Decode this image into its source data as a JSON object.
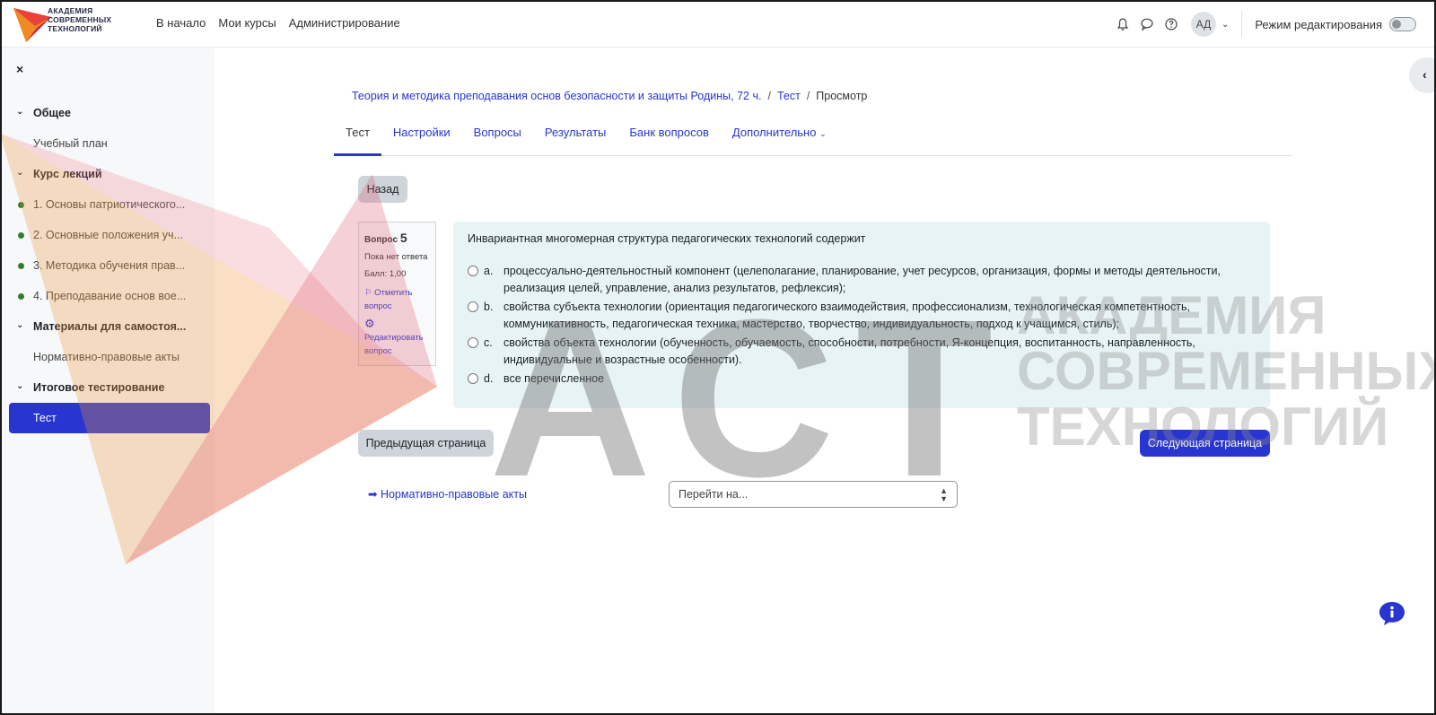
{
  "brand": {
    "logo_text_lines": [
      "АКАДЕМИЯ",
      "СОВРЕМЕННЫХ",
      "ТЕХНОЛОГИЙ"
    ],
    "accent_color": "#2835d1"
  },
  "navbar": {
    "links": [
      "В начало",
      "Мои курсы",
      "Администрирование"
    ],
    "avatar_initials": "АД",
    "edit_mode_label": "Режим редактирования"
  },
  "sidebar": {
    "close_label": "×",
    "items": [
      {
        "label": "Общее",
        "type": "section"
      },
      {
        "label": "Учебный план",
        "type": "child"
      },
      {
        "label": "Курс лекций",
        "type": "section"
      },
      {
        "label": "1. Основы патриотического...",
        "type": "child-dot"
      },
      {
        "label": "2. Основные положения уч...",
        "type": "child-dot"
      },
      {
        "label": "3. Методика обучения прав...",
        "type": "child-dot"
      },
      {
        "label": "4. Преподавание основ вое...",
        "type": "child-dot"
      },
      {
        "label": "Материалы для самостоя...",
        "type": "section"
      },
      {
        "label": "Нормативно-правовые акты",
        "type": "child"
      },
      {
        "label": "Итоговое тестирование",
        "type": "section"
      },
      {
        "label": "Тест",
        "type": "active"
      }
    ]
  },
  "watermark": {
    "big": "АСТ",
    "small_lines": [
      "АКАДЕМИЯ",
      "СОВРЕМЕННЫХ",
      "ТЕХНОЛОГИЙ"
    ]
  },
  "breadcrumb": {
    "course": "Теория и методика преподавания основ безопасности и защиты Родины, 72 ч.",
    "separator": "/",
    "quiz": "Тест",
    "current": "Просмотр"
  },
  "tabs": {
    "items": [
      "Тест",
      "Настройки",
      "Вопросы",
      "Результаты",
      "Банк вопросов"
    ],
    "more": "Дополнительно",
    "more_chevron": "⌄"
  },
  "buttons": {
    "back": "Назад",
    "prev_page": "Предыдущая страница",
    "next_page": "Следующая страница"
  },
  "question_info": {
    "label": "Вопрос",
    "number": "5",
    "status": "Пока нет ответа",
    "score": "Балл: 1,00",
    "flag_link": "Отметить вопрос",
    "edit_link": "Редактировать вопрос"
  },
  "question": {
    "text": "Инвариантная многомерная структура педагогических технологий содержит",
    "answers": [
      {
        "letter": "a.",
        "text": "процессуально-деятельностный компонент (целеполагание, планирование, учет ресурсов, организация, формы и методы деятельности, реализация целей, управление, анализ результатов, рефлексия);"
      },
      {
        "letter": "b.",
        "text": "свойства субъекта технологии (ориентация педагогического взаимодействия, профессионализм, технологическая компетентность, коммуникативность, педагогическая техника, мастерство, творчество, индивидуальность, подход к учащимся, стиль);"
      },
      {
        "letter": "c.",
        "text": "свойства объекта технологии (обученность, обучаемость, способности, потребности, Я-концепция, воспитанность, направленность, индивидуальные и возрастные особенности)."
      },
      {
        "letter": "d.",
        "text": "все перечисленное"
      }
    ]
  },
  "activity_nav": {
    "prev_activity": "➡ Нормативно-правовые акты",
    "jump_placeholder": "Перейти на..."
  }
}
